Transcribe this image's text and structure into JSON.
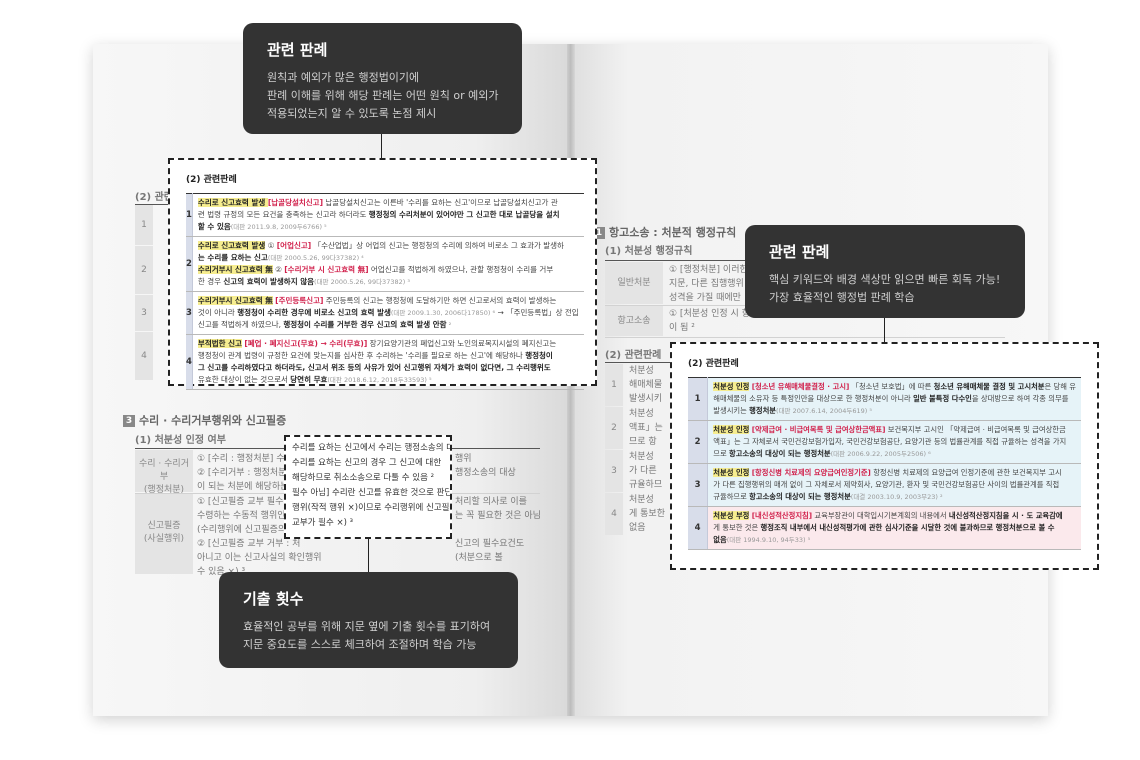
{
  "callouts": {
    "top": {
      "title": "관련 판례",
      "lines": [
        "원칙과 예외가 많은 행정법이기에",
        "판례 이해를 위해 해당 판례는 어떤 원칙 or 예외가",
        "적용되었는지 알 수 있도록 논점 제시"
      ]
    },
    "right": {
      "title": "관련 판례",
      "lines": [
        "핵심 키워드와 배경 색상만 읽으면 빠른 회독 가능!",
        "가장 효율적인 행정법 판례 학습"
      ]
    },
    "bottom": {
      "title": "기출 횟수",
      "lines": [
        "효율적인 공부를 위해 지문 옆에 기출 횟수를 표기하여",
        "지문 중요도를 스스로 체크하여 조절하며 학습 가능"
      ]
    }
  },
  "left_box": {
    "title": "(2) 관련판례",
    "rows": [
      {
        "num": "1",
        "lines": [
          {
            "seg": [
              {
                "t": "수리로 신고효력 발생 ",
                "c": "hl"
              },
              {
                "t": "[납골당설치신고]",
                "c": "red"
              },
              {
                "t": " 납골당설치신고는 이른바 '수리를 요하는 신고'이므로 납골당설치신고가 관"
              }
            ]
          },
          {
            "seg": [
              {
                "t": "련 법령 규정의 모든 요건을 충족하는 신고라 하더라도 "
              },
              {
                "t": "행정청의 수리처분이 있어야만 그 신고한 대로 납골당을 설치",
                "c": "b"
              }
            ]
          },
          {
            "seg": [
              {
                "t": "할 수 있음",
                "c": "b"
              },
              {
                "t": "(대판 2011.9.8, 2009두6766) ⁵",
                "c": "cite"
              }
            ]
          }
        ]
      },
      {
        "num": "2",
        "lines": [
          {
            "seg": [
              {
                "t": "수리로 신고효력 발생",
                "c": "hl"
              },
              {
                "t": " ① "
              },
              {
                "t": "[어업신고]",
                "c": "red"
              },
              {
                "t": " 「수산업법」상 어업의 신고는 행정청의 수리에 의하여 비로소 그 효과가 발생하"
              }
            ]
          },
          {
            "seg": [
              {
                "t": "는 수리를 요하는 신고",
                "c": "b"
              },
              {
                "t": "(대판 2000.5.26, 99다37382) ⁴",
                "c": "cite"
              }
            ]
          },
          {
            "seg": [
              {
                "t": "수리거부시 신고효력 無",
                "c": "hl"
              },
              {
                "t": " ② "
              },
              {
                "t": "[수리거부 시 신고효력 無]",
                "c": "red"
              },
              {
                "t": " 어업신고를 적법하게 하였으나, 관할 행정청이 수리를 거부"
              }
            ]
          },
          {
            "seg": [
              {
                "t": "한 경우 "
              },
              {
                "t": "신고의 효력이 발생하지 않음",
                "c": "b"
              },
              {
                "t": "(대판 2000.5.26, 99다37382) ³",
                "c": "cite"
              }
            ]
          }
        ]
      },
      {
        "num": "3",
        "lines": [
          {
            "seg": [
              {
                "t": "수리거부시 신고효력 無",
                "c": "hl"
              },
              {
                "t": " "
              },
              {
                "t": "[주민등록신고]",
                "c": "red"
              },
              {
                "t": " 주민등록의 신고는 행정청에 도달하기만 하면 신고로서의 효력이 발생하는"
              }
            ]
          },
          {
            "seg": [
              {
                "t": "것이 아니라 "
              },
              {
                "t": "행정청이 수리한 경우에 비로소 신고의 효력 발생",
                "c": "b"
              },
              {
                "t": "(대판 2009.1.30, 2006다17850) ⁶",
                "c": "cite"
              },
              {
                "t": " → 「주민등록법」상 전입"
              }
            ]
          },
          {
            "seg": [
              {
                "t": "신고를 적법하게 하였으나, "
              },
              {
                "t": "행정청이 수리를 거부한 경우 신고의 효력 발생 안함",
                "c": "b"
              },
              {
                "t": " ²",
                "c": "cite"
              }
            ]
          }
        ]
      },
      {
        "num": "4",
        "lines": [
          {
            "seg": [
              {
                "t": "부적법한 신고",
                "c": "hl"
              },
              {
                "t": " "
              },
              {
                "t": "[폐업 · 폐지신고(무효) → 수리(무효)]",
                "c": "red"
              },
              {
                "t": " 장기요양기관의 폐업신고와 노인의료복지시설의 폐지신고는"
              }
            ]
          },
          {
            "seg": [
              {
                "t": "행정청이 관계 법령이 규정한 요건에 맞는지를 심사한 후 수리하는 '수리를 필요로 하는 신고'에 해당하나 "
              },
              {
                "t": "행정청이",
                "c": "b"
              }
            ]
          },
          {
            "seg": [
              {
                "t": "그 신고를 수리하였다고 하더라도, 신고서 위조 등의 사유가 있어 신고행위 자체가 효력이 없다면, 그 수리행위도",
                "c": "b"
              }
            ]
          },
          {
            "seg": [
              {
                "t": "유효한 대상이 없는 것으로서 "
              },
              {
                "t": "당연히 무효",
                "c": "b"
              },
              {
                "t": "(대판 2018.6.12, 2018두33593) ⁵",
                "c": "cite"
              }
            ]
          }
        ]
      }
    ]
  },
  "right_box": {
    "title": "(2) 관련판례",
    "rows": [
      {
        "num": "1",
        "style": "blue",
        "lines": [
          {
            "seg": [
              {
                "t": "처분성 인정",
                "c": "hl"
              },
              {
                "t": " "
              },
              {
                "t": "[청소년 유해매체물결정 · 고시]",
                "c": "red"
              },
              {
                "t": " 「청소년 보호법」에 따른 "
              },
              {
                "t": "청소년 유해매체물 결정 및 고시처분",
                "c": "b"
              },
              {
                "t": "은 당해 유"
              }
            ]
          },
          {
            "seg": [
              {
                "t": "해매체물의 소유자 등 특정인만을 대상으로 한 행정처분이 아니라 "
              },
              {
                "t": "일반 불특정 다수인",
                "c": "b"
              },
              {
                "t": "을 상대방으로 하여 각종 의무를"
              }
            ]
          },
          {
            "seg": [
              {
                "t": "발생시키는 "
              },
              {
                "t": "행정처분",
                "c": "b"
              },
              {
                "t": "(대판 2007.6.14, 2004두619) ⁵",
                "c": "cite"
              }
            ]
          }
        ]
      },
      {
        "num": "2",
        "style": "blue",
        "lines": [
          {
            "seg": [
              {
                "t": "처분성 인정",
                "c": "hl"
              },
              {
                "t": " "
              },
              {
                "t": "[약제급여 · 비급여목록 및 급여상한금액표]",
                "c": "red"
              },
              {
                "t": " 보건복지부 고시인 「약제급여 · 비급여목록 및 급여상한금"
              }
            ]
          },
          {
            "seg": [
              {
                "t": "액표」는 그 자체로서 국민건강보험가입자, 국민건강보험공단, 요양기관 등의 법률관계를 직접 규율하는 성격을 가지"
              }
            ]
          },
          {
            "seg": [
              {
                "t": "므로 "
              },
              {
                "t": "항고소송의 대상이 되는 행정처분",
                "c": "b"
              },
              {
                "t": "(대판 2006.9.22, 2005두2506) ⁶",
                "c": "cite"
              }
            ]
          }
        ]
      },
      {
        "num": "3",
        "style": "blue",
        "lines": [
          {
            "seg": [
              {
                "t": "처분성 인정",
                "c": "hl"
              },
              {
                "t": " "
              },
              {
                "t": "[항정신병 치료제의 요양급여인정기준]",
                "c": "red"
              },
              {
                "t": " 항정신병 치료제의 요양급여 인정기준에 관한 보건복지부 고시"
              }
            ]
          },
          {
            "seg": [
              {
                "t": "가 다른 집행행위의 매개 없이 그 자체로서 제약회사, 요양기관, 환자 및 국민건강보험공단 사이의 법률관계를 직접"
              }
            ]
          },
          {
            "seg": [
              {
                "t": "규율하므로 "
              },
              {
                "t": "항고소송의 대상이 되는 행정처분",
                "c": "b"
              },
              {
                "t": "(대결 2003.10.9, 2003무23) ²",
                "c": "cite"
              }
            ]
          }
        ]
      },
      {
        "num": "4",
        "style": "red",
        "lines": [
          {
            "seg": [
              {
                "t": "처분성 부정",
                "c": "hl"
              },
              {
                "t": " "
              },
              {
                "t": "[내신성적산정지침]",
                "c": "red"
              },
              {
                "t": " 교육부장관이 대학입시기본계획의 내용에서 "
              },
              {
                "t": "내신성적산정지침을 시 · 도 교육감에",
                "c": "b"
              }
            ]
          },
          {
            "seg": [
              {
                "t": "게 통보한 것은 "
              },
              {
                "t": "행정조직 내부에서 내신성적평가에 관한 심사기준을 시달한 것에 불과하므로 행정처분으로 볼 수",
                "c": "b"
              }
            ]
          },
          {
            "seg": [
              {
                "t": "없음",
                "c": "b"
              },
              {
                "t": "(대판 1994.9.10, 94두33) ⁵",
                "c": "cite"
              }
            ]
          }
        ]
      }
    ]
  },
  "background": {
    "left_partial_title": "(2) 관련",
    "left_row_nums": [
      "1",
      "2",
      "3",
      "4"
    ],
    "left_section": "수리 · 수리거부행위와 신고필증",
    "left_section_num": "3",
    "left_sub": "(1) 처분성 인정 여부",
    "left_cell_a": [
      "수리 · 수리거부",
      "(행정처분)"
    ],
    "left_cell_b": [
      "신고필증",
      "(사실행위)"
    ],
    "left_lines_a": [
      "① [수리 : 행정처분] 수리는",
      "② [수리거부 : 행정처분] 수리",
      "이 되는 처분에 해당하는"
    ],
    "left_lines_b": [
      "① [신고필증 교부 필수 아님]",
      "수령하는 수동적 행위인",
      "(수리행위에 신고필증의",
      "② [신고필증 교부 거부 : 처",
      "아니고 이는 신고사실의 확인행위",
      "수 있음 ×) ³"
    ],
    "left_lines_b_right": [
      "처리할 의사로 이를",
      "는 꼭 필요한 것은 아님",
      "신고의 필수요건도",
      "(처분으로 볼"
    ],
    "left_lines_a_right": [
      "행위",
      "행정소송의 대상"
    ],
    "mid_lines": [
      "수리를 요하는 신고에서 수리는 행정소송의 대상",
      "수리를 요하는 신고의 경우 그 신고에 대한",
      "해당하므로 취소소송으로 다툴 수 있음 ²",
      "필수 아님] 수리란 신고를 유효한 것으로 판단하고",
      "행위(작적 행위 ×)이므로 수리행위에 신고필증 교",
      "교부가 필수 ×) ³"
    ],
    "right_section": "항고소송 : 처분적 행정규칙",
    "right_section_num": "1",
    "right_sub": "(1) 처분성 행정규칙",
    "right_cell_a": "일반처분",
    "right_cell_b": "항고소송",
    "right_lines_a": [
      "① [행정처분] 이러한",
      "지문, 다른 집행행위",
      "성격을 가질 때에만"
    ],
    "right_lines_b": [
      "① [처분성 인정 시 항",
      "이 됨 ²"
    ],
    "right_partial_title": "(2) 관련판례",
    "right_row_nums": [
      "1",
      "2",
      "3",
      "4"
    ],
    "right_row_texts": [
      "처분성",
      "해매체물",
      "발생시키",
      "처분성",
      "액표」는",
      "므로 항",
      "처분성",
      "가 다른",
      "규율하므",
      "처분성",
      "게 통보한",
      "없음"
    ]
  }
}
